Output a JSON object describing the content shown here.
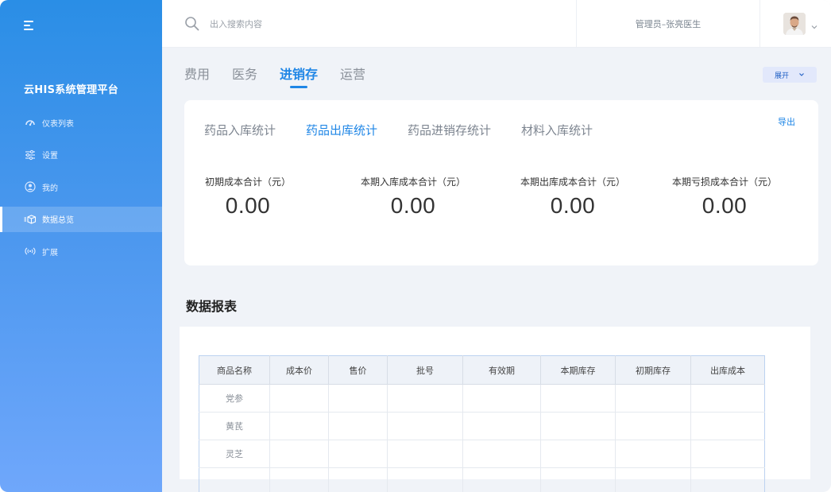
{
  "sidebar": {
    "title": "云HIS系统管理平台",
    "items": [
      {
        "label": "仪表列表",
        "icon": "gauge-icon"
      },
      {
        "label": "设置",
        "icon": "sliders-icon"
      },
      {
        "label": "我的",
        "icon": "user-circle-icon"
      },
      {
        "label": "数据总览",
        "icon": "cube-data-icon"
      },
      {
        "label": "扩展",
        "icon": "broadcast-icon"
      }
    ],
    "active_index": 3
  },
  "topbar": {
    "search_placeholder": "出入搜索内容",
    "user_label": "管理员–张亮医生"
  },
  "main_tabs": [
    "费用",
    "医务",
    "进销存",
    "运营"
  ],
  "main_tab_active": 2,
  "expand_label": "展开",
  "stats_card": {
    "sub_tabs": [
      "药品入库统计",
      "药品出库统计",
      "药品进销存统计",
      "材料入库统计"
    ],
    "sub_tab_active": 1,
    "export_label": "导出",
    "stats": [
      {
        "label": "初期成本合计（元）",
        "value": "0.00"
      },
      {
        "label": "本期入库成本合计（元）",
        "value": "0.00"
      },
      {
        "label": "本期出库成本合计（元）",
        "value": "0.00"
      },
      {
        "label": "本期亏损成本合计（元）",
        "value": "0.00"
      }
    ]
  },
  "report": {
    "title": "数据报表",
    "columns": [
      "商品名称",
      "成本价",
      "售价",
      "批号",
      "有效期",
      "本期库存",
      "初期库存",
      "出库成本"
    ],
    "rows": [
      [
        "党参",
        "",
        "",
        "",
        "",
        "",
        "",
        ""
      ],
      [
        "黄芪",
        "",
        "",
        "",
        "",
        "",
        "",
        ""
      ],
      [
        "灵芝",
        "",
        "",
        "",
        "",
        "",
        "",
        ""
      ],
      [
        "",
        "",
        "",
        "",
        "",
        "",
        "",
        ""
      ]
    ]
  },
  "colors": {
    "accent": "#1f86e6",
    "sidebar_top": "#2a8ee6",
    "sidebar_bottom": "#6fa7fb",
    "page_bg": "#f0f3f8"
  }
}
